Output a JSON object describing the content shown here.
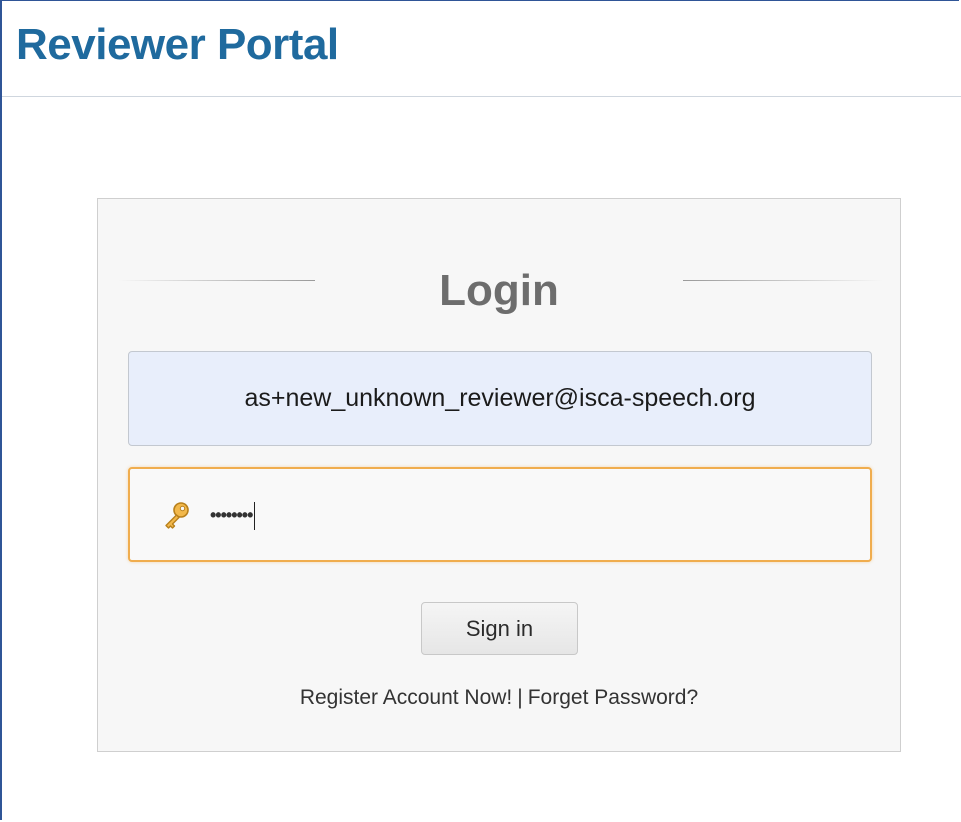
{
  "header": {
    "title": "Reviewer Portal"
  },
  "login": {
    "heading": "Login",
    "email_value": "as+new_unknown_reviewer@isca-speech.org",
    "password_masked": "••••••••",
    "password_icon": "key-icon",
    "sign_in_label": "Sign in",
    "register_link": "Register Account Now!",
    "separator": "|",
    "forgot_link": "Forget Password?"
  },
  "colors": {
    "title": "#1f6a9e",
    "focus_border": "#f0ad4e",
    "email_bg": "#e8eefb"
  }
}
